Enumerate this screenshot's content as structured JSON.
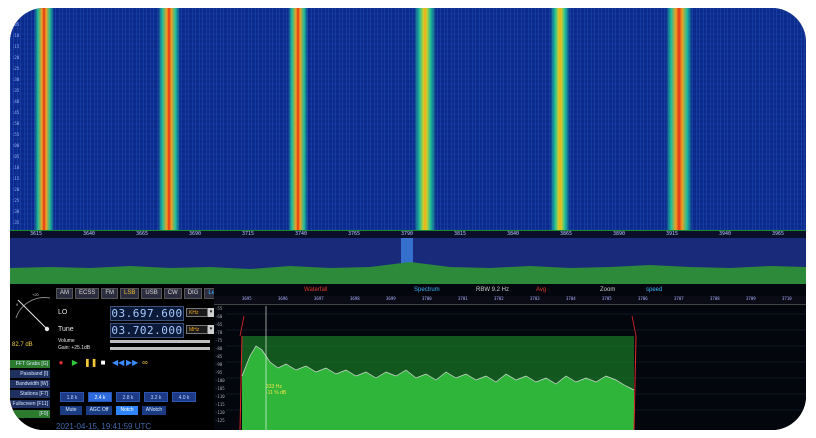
{
  "modes": [
    "AM",
    "ECSS",
    "FM",
    "LSB",
    "USB",
    "CW",
    "DIG",
    "Levels"
  ],
  "active_mode": "LSB",
  "lo": {
    "label": "LO",
    "value": "03.697.600",
    "unit": "KHz"
  },
  "tune": {
    "label": "Tune",
    "value": "03.702.000",
    "unit": "MHz"
  },
  "volume_label": "Volume",
  "gain_label": "Gain: +25.1dB",
  "smeter_value": "82.7 dB",
  "side_buttons": [
    "FFT Grabs [G]",
    "Passband [I]",
    "Bandwidth [W]",
    "Stations [F7]",
    "Fullscreen [F11]",
    "[F9]"
  ],
  "filter_buttons": [
    "1.8 k",
    "2.4 k",
    "2.8 k",
    "3.2 k",
    "4.0 k"
  ],
  "selected_filter": "2.4 k",
  "dsp_buttons": [
    "Mute",
    "AGC Off",
    "Notch",
    "ANotch"
  ],
  "active_dsp": "Notch",
  "datetime": "2021-04-15, 19:41:59 UTC",
  "spectrum_bar": {
    "waterfall_label": "Waterfall",
    "spectrum_label": "Spectrum",
    "rbw_label": "RBW 9.2 Hz",
    "avg_label": "Avg",
    "zoom_label": "Zoom",
    "speed_label": "speed"
  },
  "bandwidth_annotation": "333 Hz",
  "bandwidth_sub": "-11 % dB",
  "waterfall_freq_ticks": [
    "3615",
    "3640",
    "3665",
    "3690",
    "3715",
    "3740",
    "3765",
    "3790",
    "3815",
    "3840",
    "3865",
    "3890",
    "3915",
    "3940",
    "3965"
  ],
  "spectrum_freq_ticks": [
    "3695",
    "3696",
    "3697",
    "3698",
    "3699",
    "3700",
    "3701",
    "3702",
    "3703",
    "3704",
    "3705",
    "3706",
    "3707",
    "3708",
    "3709",
    "3710"
  ],
  "db_ticks": [
    "-55",
    "-60",
    "-65",
    "-70",
    "-75",
    "-80",
    "-85",
    "-90",
    "-95",
    "-100",
    "-105",
    "-110",
    "-115",
    "-120",
    "-125"
  ],
  "colors": {
    "spectrum_fill": "#1f9a2e",
    "accent": "#2f84ff",
    "active_mode": "#f3c032",
    "filter_edge": "#e02a2a"
  }
}
